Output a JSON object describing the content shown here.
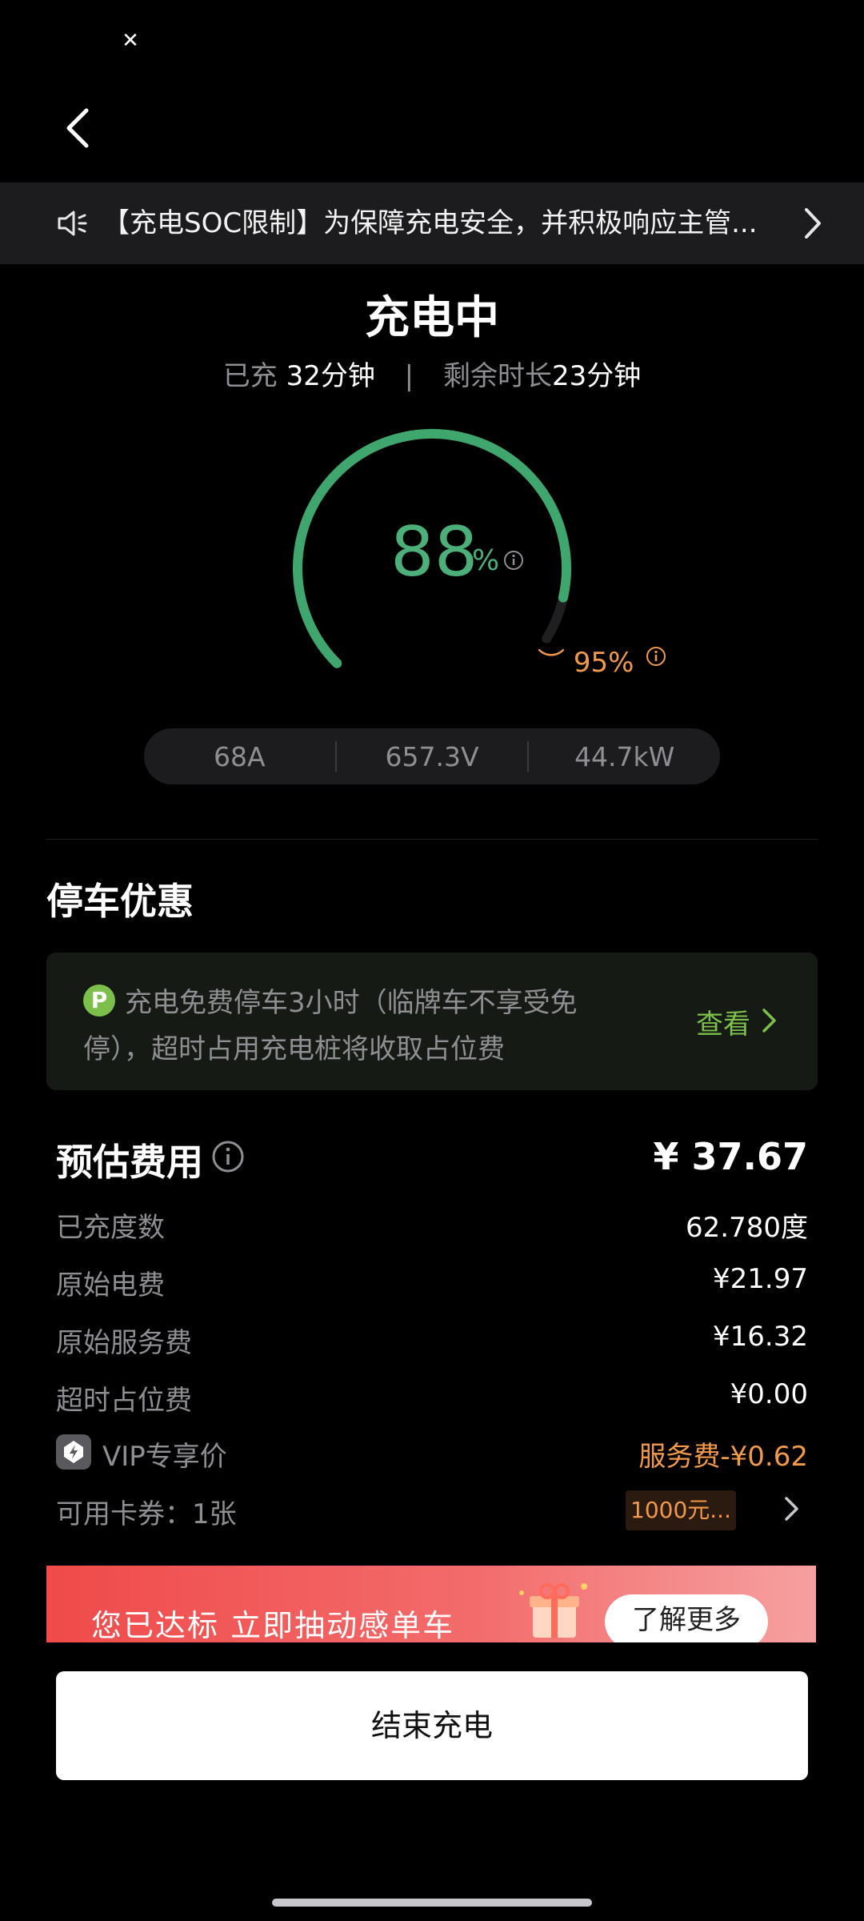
{
  "status_bar": {
    "app_icon": "x-logo-icon"
  },
  "nav": {
    "back_icon": "chevron-left-icon"
  },
  "notice": {
    "icon": "speaker-icon",
    "text": "【充电SOC限制】为保障充电安全，并积极响应主管...",
    "arrow_icon": "chevron-right-icon"
  },
  "charging": {
    "status": "充电中",
    "charged_label": "已充",
    "charged_value": "32分钟",
    "separator": "|",
    "remaining_label": "剩余时长",
    "remaining_value": "23分钟",
    "soc_percent": 88,
    "soc_value": "88",
    "soc_unit": "%",
    "soc_target": 95,
    "soc_target_text": "95%",
    "accent_green": "#3fa66e",
    "accent_orange": "#f2994a"
  },
  "metrics": [
    {
      "label": "68A"
    },
    {
      "label": "657.3V"
    },
    {
      "label": "44.7kW"
    }
  ],
  "parking": {
    "section_title": "停车优惠",
    "badge": "P",
    "text": "充电免费停车3小时（临牌车不享受免停），超时占用充电桩将收取占位费",
    "view_label": "查看"
  },
  "fees": {
    "title": "预估费用",
    "total": "¥ 37.67",
    "rows": [
      {
        "label": "已充度数",
        "value": "62.780度"
      },
      {
        "label": "原始电费",
        "value": "¥21.97"
      },
      {
        "label": "原始服务费",
        "value": "¥16.32"
      },
      {
        "label": "超时占位费",
        "value": "¥0.00"
      }
    ],
    "vip_label": "VIP专享价",
    "vip_value": "服务费-¥0.62",
    "coupon_label": "可用卡券：1张",
    "coupon_value": "1000元..."
  },
  "banner": {
    "text": "您已达标 立即抽动感单车",
    "button": "了解更多"
  },
  "end_button": "结束充电"
}
